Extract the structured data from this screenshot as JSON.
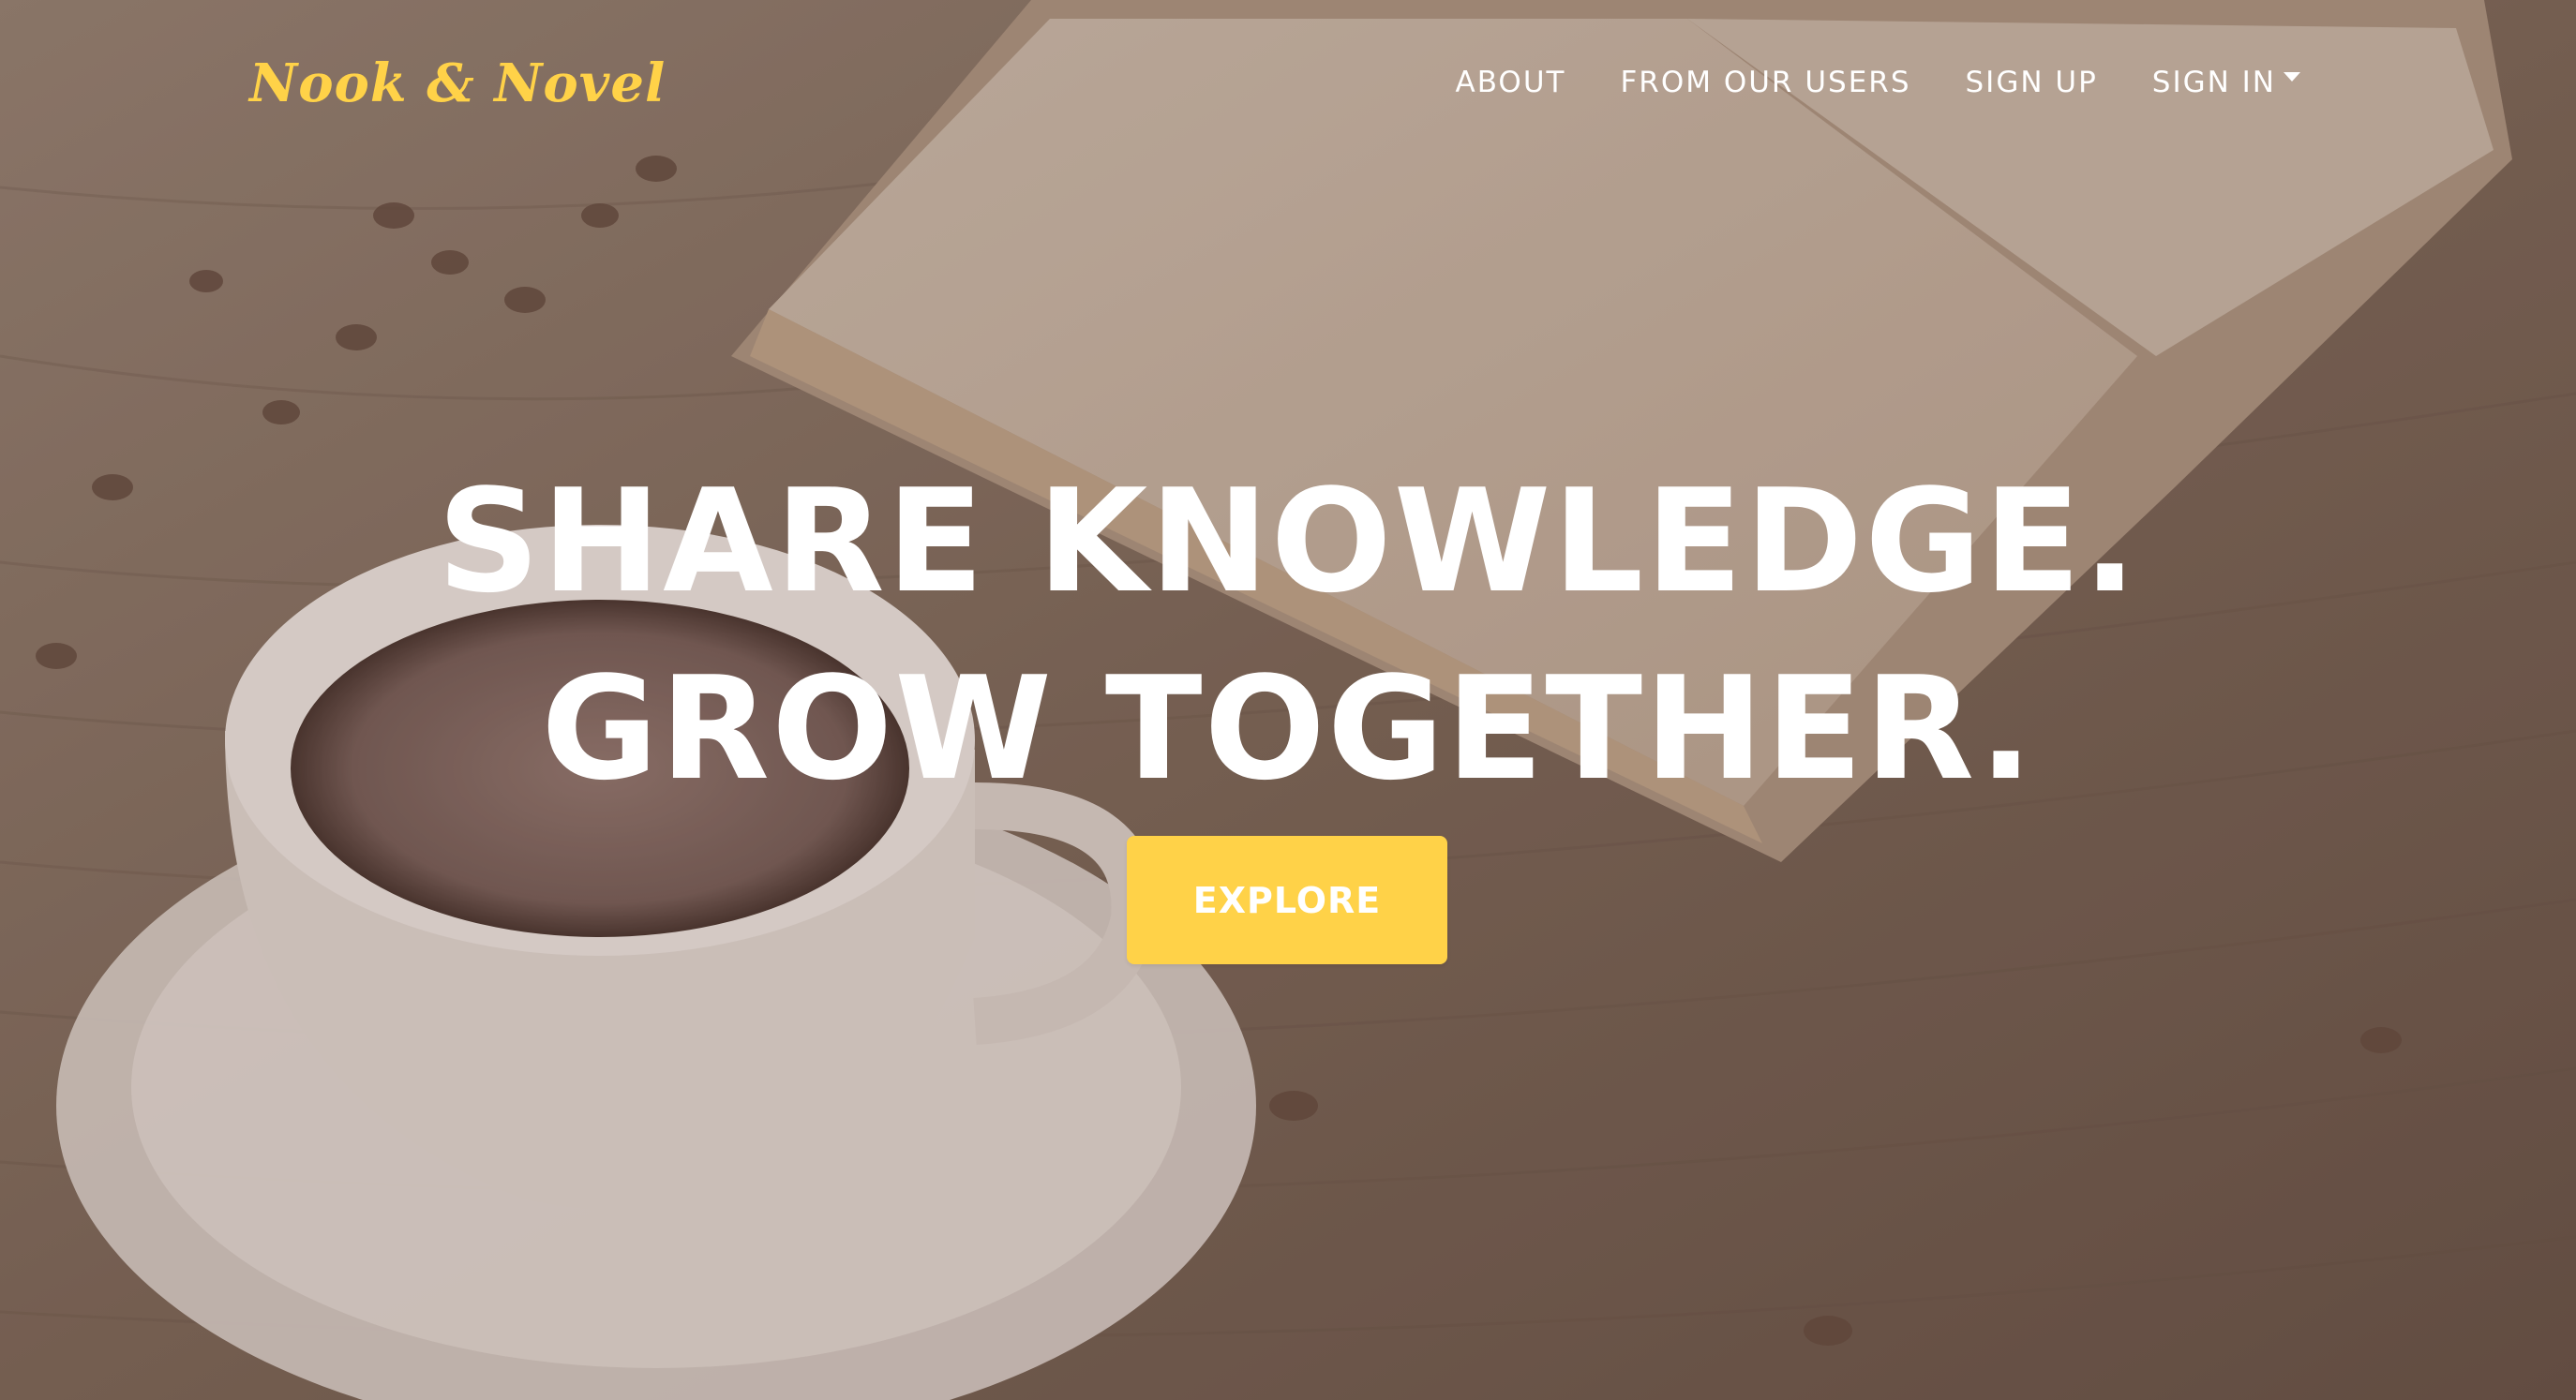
{
  "nav": {
    "brand": "Nook & Novel",
    "links": [
      {
        "label": "ABOUT"
      },
      {
        "label": "FROM OUR USERS"
      },
      {
        "label": "SIGN UP"
      },
      {
        "label": "SIGN IN",
        "has_dropdown": true
      }
    ]
  },
  "hero": {
    "headline_line1": "SHARE KNOWLEDGE.",
    "headline_line2": "GROW TOGETHER.",
    "cta_label": "EXPLORE",
    "background_image": "coffee cup and open book on wooden table"
  },
  "colors": {
    "accent": "#ffd248",
    "text": "#ffffff",
    "overlay": "#785f55"
  }
}
